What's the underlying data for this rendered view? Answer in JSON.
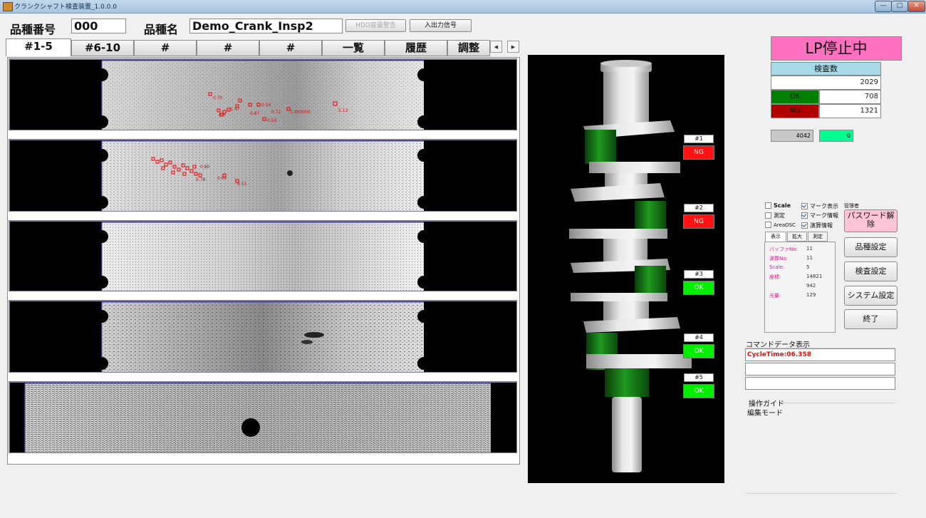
{
  "window": {
    "title": "クランクシャフト検査装置_1.0.0.0"
  },
  "header": {
    "product_no_label": "品種番号",
    "product_no_value": "000",
    "product_name_label": "品種名",
    "product_name_value": "Demo_Crank_Insp2",
    "hdd_button": "HDD容量警告",
    "io_button": "入出力信号"
  },
  "tabs": [
    "#1-5",
    "#6-10",
    "#",
    "#",
    "#",
    "一覧",
    "履歴",
    "調整"
  ],
  "defect_labels": {
    "strip1": [
      "0.70",
      "1.47",
      "0.54",
      "0.87",
      "0.72",
      "1.000000",
      "0.53",
      "5.13",
      "0.6"
    ],
    "strip2": [
      "0.80",
      "0.64",
      "0.51",
      "0.78"
    ]
  },
  "viewer": {
    "cylinders": [
      {
        "label": "#1",
        "result": "NG"
      },
      {
        "label": "#2",
        "result": "NG"
      },
      {
        "label": "#3",
        "result": "OK"
      },
      {
        "label": "#4",
        "result": "OK"
      },
      {
        "label": "#5",
        "result": "OK"
      }
    ]
  },
  "status": {
    "text": "LP停止中",
    "color": "#ff70c0"
  },
  "counts": {
    "header": "検査数",
    "total": "2029",
    "ok_label": "OK",
    "ok": "708",
    "ng_label": "NG",
    "ng": "1321"
  },
  "small_values": {
    "left": "4042",
    "right": "0"
  },
  "options": {
    "scale": "Scale",
    "measure": "測定",
    "areaosc": "AreaOSC",
    "mark_display": "マーク表示",
    "mark_info": "マーク情報",
    "calc_info": "演算情報",
    "admin": "管理者"
  },
  "subtabs": [
    "表示",
    "拡大",
    "測定"
  ],
  "info": [
    {
      "key": "バッファNo:",
      "value": "11"
    },
    {
      "key": "演算No:",
      "value": "11"
    },
    {
      "key": "Scale:",
      "value": "5"
    },
    {
      "key": "座標:",
      "value": "14821"
    },
    {
      "key": "",
      "value": "942"
    },
    {
      "key": "光量:",
      "value": "129"
    }
  ],
  "right_buttons": {
    "password": "パスワード解除",
    "product_settings": "品種設定",
    "inspection_settings": "検査設定",
    "system_settings": "システム設定",
    "exit": "終了"
  },
  "command": {
    "label": "コマンドデータ表示",
    "line1": "CycleTime:06.358",
    "line2": "",
    "line3": ""
  },
  "guide": {
    "title": "操作ガイド",
    "mode": "編集モード"
  }
}
